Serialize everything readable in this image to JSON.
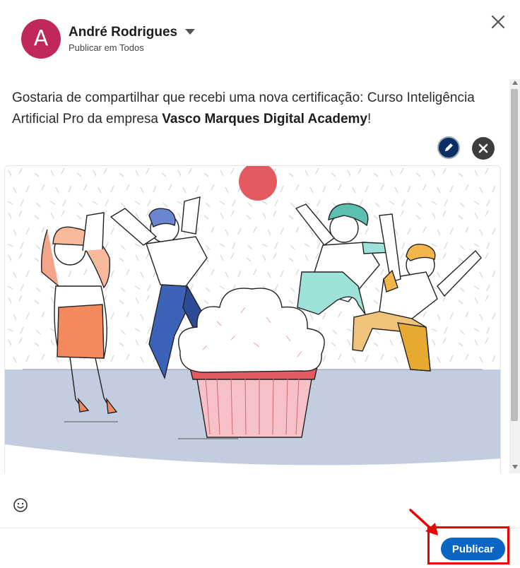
{
  "header": {
    "avatar_letter": "A",
    "user_name": "André Rodrigues",
    "audience": "Publicar em Todos"
  },
  "post": {
    "text_part1": "Gostaria de compartilhar que recebi uma nova certificação: Curso Inteligência Artificial Pro da empresa ",
    "text_bold": "Vasco Marques Digital Academy",
    "text_part2": "!"
  },
  "actions": {
    "publish_label": "Publicar"
  },
  "icons": {
    "close": "close-icon",
    "dropdown": "chevron-down-icon",
    "edit": "pencil-icon",
    "remove": "x-icon",
    "emoji": "smiley-icon"
  },
  "colors": {
    "avatar": "#c1275a",
    "publish": "#0a66c2",
    "highlight": "#ee0000"
  }
}
